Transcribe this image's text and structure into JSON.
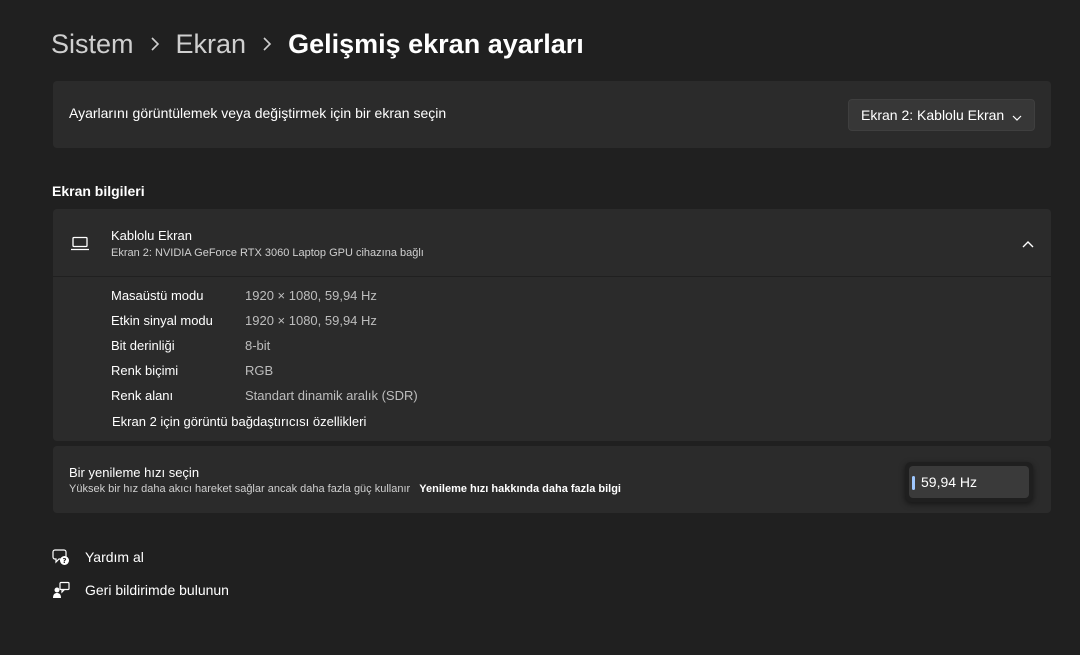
{
  "breadcrumb": {
    "items": [
      "Sistem",
      "Ekran",
      "Gelişmiş ekran ayarları"
    ]
  },
  "display_select": {
    "label": "Ayarlarını görüntülemek veya değiştirmek için bir ekran seçin",
    "value": "Ekran 2: Kablolu Ekran"
  },
  "display_info": {
    "section_title": "Ekran bilgileri",
    "name": "Kablolu Ekran",
    "subtitle": "Ekran 2: NVIDIA GeForce RTX 3060 Laptop GPU cihazına bağlı",
    "rows": [
      {
        "key": "Masaüstü modu",
        "value": "1920 × 1080, 59,94 Hz"
      },
      {
        "key": "Etkin sinyal modu",
        "value": "1920 × 1080, 59,94 Hz"
      },
      {
        "key": "Bit derinliği",
        "value": "8-bit"
      },
      {
        "key": "Renk biçimi",
        "value": "RGB"
      },
      {
        "key": "Renk alanı",
        "value": "Standart dinamik aralık (SDR)"
      }
    ],
    "adapter_link": "Ekran 2 için görüntü bağdaştırıcısı özellikleri"
  },
  "refresh": {
    "title": "Bir yenileme hızı seçin",
    "description": "Yüksek bir hız daha akıcı hareket sağlar ancak daha fazla güç kullanır",
    "more_link": "Yenileme hızı hakkında daha fazla bilgi",
    "value": "59,94 Hz"
  },
  "footer": {
    "help": "Yardım al",
    "feedback": "Geri bildirimde bulunun"
  },
  "icons": {
    "monitor": "laptop-icon",
    "help": "help-icon",
    "feedback": "feedback-icon"
  },
  "colors": {
    "background": "#202020",
    "card": "#2b2b2b",
    "accent": "#9ec7ff"
  }
}
